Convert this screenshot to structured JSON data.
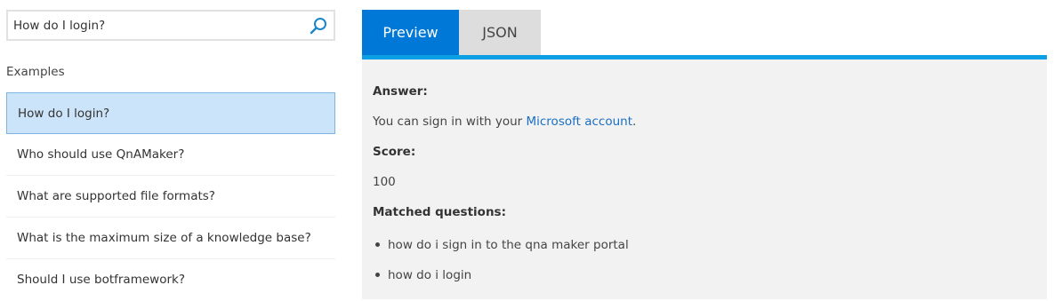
{
  "search": {
    "value": "How do I login?"
  },
  "examples": {
    "label": "Examples",
    "items": [
      "How do I login?",
      "Who should use QnAMaker?",
      "What are supported file formats?",
      "What is the maximum size of a knowledge base?",
      "Should I use botframework?"
    ],
    "selected_index": 0
  },
  "tabs": {
    "preview": "Preview",
    "json": "JSON",
    "active": "Preview"
  },
  "result": {
    "answer_heading": "Answer:",
    "answer_prefix": "You can sign in with your ",
    "answer_link": "Microsoft account",
    "answer_suffix": ".",
    "score_heading": "Score:",
    "score": "100",
    "matched_heading": "Matched questions:",
    "matched": [
      "how do i sign in to the qna maker portal",
      "how do i login"
    ]
  },
  "colors": {
    "accent": "#0078d7",
    "tab_underline": "#0aa0e3",
    "selected_bg": "#cce4f9",
    "link": "#1a6fc2"
  }
}
